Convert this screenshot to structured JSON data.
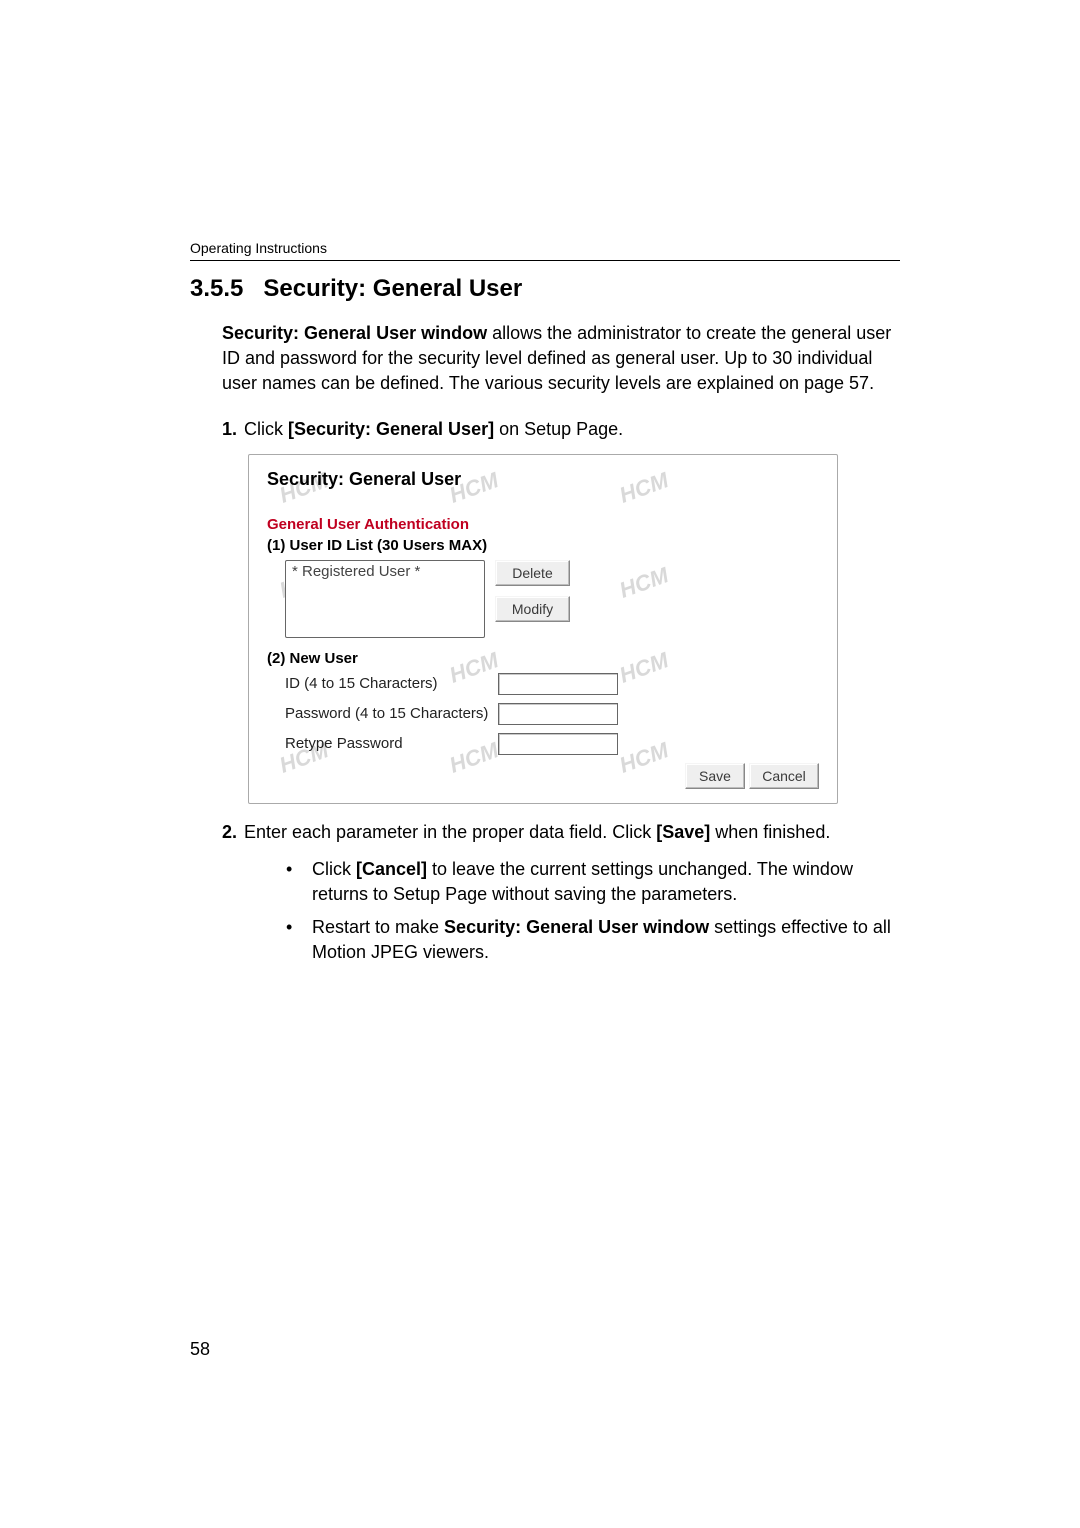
{
  "header": {
    "running": "Operating Instructions"
  },
  "section": {
    "number": "3.5.5",
    "title": "Security: General User"
  },
  "intro": {
    "lead_bold": "Security: General User window",
    "lead_rest": " allows the administrator to create the general user ID and password for the security level defined as general user. Up to 30 individual user names can be defined. The various security levels are explained on page 57."
  },
  "steps": {
    "s1": {
      "num": "1.",
      "pre": "Click ",
      "bold": "[Security: General User]",
      "post": " on Setup Page."
    },
    "s2": {
      "num": "2.",
      "pre": "Enter each parameter in the proper data field. Click ",
      "bold": "[Save]",
      "post": " when finished."
    }
  },
  "panel": {
    "title": "Security: General User",
    "auth_heading": "General User Authentication",
    "list_heading": "(1)  User ID List (30 Users MAX)",
    "registered_placeholder": "* Registered User *",
    "btn_delete": "Delete",
    "btn_modify": "Modify",
    "newuser_heading": "(2)  New User",
    "id_label": "ID (4 to 15 Characters)",
    "pw_label": "Password (4 to 15 Characters)",
    "repw_label": "Retype Password",
    "btn_save": "Save",
    "btn_cancel": "Cancel",
    "wm_text": "HCM"
  },
  "bullets": {
    "b1_pre": "Click ",
    "b1_bold": "[Cancel]",
    "b1_post": " to leave the current settings unchanged. The window returns to Setup Page without saving the parameters.",
    "b2_pre": "Restart to make ",
    "b2_bold": "Security: General User window",
    "b2_post": " settings effective to all Motion JPEG viewers."
  },
  "page_number": "58"
}
